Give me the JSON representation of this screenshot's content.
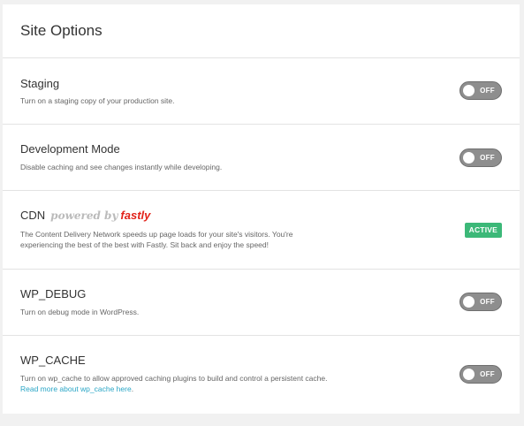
{
  "header": {
    "title": "Site Options"
  },
  "staging": {
    "title": "Staging",
    "description": "Turn on a staging copy of your production site.",
    "toggle_state": "OFF"
  },
  "dev_mode": {
    "title": "Development Mode",
    "description": "Disable caching and see changes instantly while developing.",
    "toggle_state": "OFF"
  },
  "cdn": {
    "title": "CDN",
    "powered_by": "powered by",
    "brand": "fastly",
    "description": "The Content Delivery Network speeds up page loads for your site's visitors. You're experiencing the best of the best with Fastly. Sit back and enjoy the speed!",
    "status": "ACTIVE"
  },
  "wp_debug": {
    "title": "WP_DEBUG",
    "description": "Turn on debug mode in WordPress.",
    "toggle_state": "OFF"
  },
  "wp_cache": {
    "title": "WP_CACHE",
    "description": "Turn on wp_cache to allow approved caching plugins to build and control a persistent cache.",
    "link_text": "Read more about wp_cache here",
    "link_suffix": ".",
    "toggle_state": "OFF"
  },
  "colors": {
    "toggle_off": "#8e8e8e",
    "active_badge": "#3cb878",
    "link": "#2aa6c6",
    "brand_fastly": "#e2231a"
  }
}
